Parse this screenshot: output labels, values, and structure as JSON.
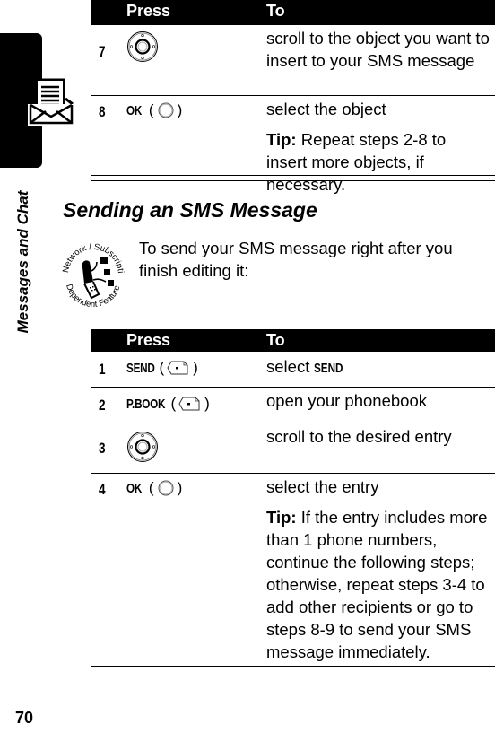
{
  "sidebar": {
    "section_label": "Messages and Chat",
    "icon": "envelope-message-icon"
  },
  "page_number": "70",
  "table1": {
    "headers": {
      "press": "Press",
      "to": "To"
    },
    "rows": [
      {
        "step": "7",
        "press_icon": "navigation-key-icon",
        "to": "scroll to the object you want to insert to your SMS message"
      },
      {
        "step": "8",
        "press_key": "OK",
        "press_icon": "center-select-key-icon",
        "to": "select the object",
        "tip_label": "Tip:",
        "tip": " Repeat steps 2-8 to insert more objects, if necessary."
      }
    ]
  },
  "section": {
    "heading": "Sending an SMS Message",
    "feature_icon": "network-subscription-dependent-feature-icon",
    "feature_icon_text_top": "Network / Subscription",
    "feature_icon_text_bottom": "Dependent Feature",
    "intro": "To send your SMS message right after you finish editing it:"
  },
  "table2": {
    "headers": {
      "press": "Press",
      "to": "To"
    },
    "rows": [
      {
        "step": "1",
        "press_key": "SEND",
        "press_icon": "right-soft-key-icon",
        "to_prefix": "select ",
        "to_key": "SEND"
      },
      {
        "step": "2",
        "press_key": "P.BOOK",
        "press_icon": "right-soft-key-icon",
        "to": "open your phonebook"
      },
      {
        "step": "3",
        "press_icon": "navigation-key-icon",
        "to": "scroll to the desired entry"
      },
      {
        "step": "4",
        "press_key": "OK",
        "press_icon": "center-select-key-icon",
        "to": "select the entry",
        "tip_label": "Tip:",
        "tip": " If the entry includes more than 1 phone numbers, continue the following steps; otherwise, repeat steps 3-4 to add other recipients or go to steps 8-9 to send your SMS message immediately."
      }
    ]
  }
}
